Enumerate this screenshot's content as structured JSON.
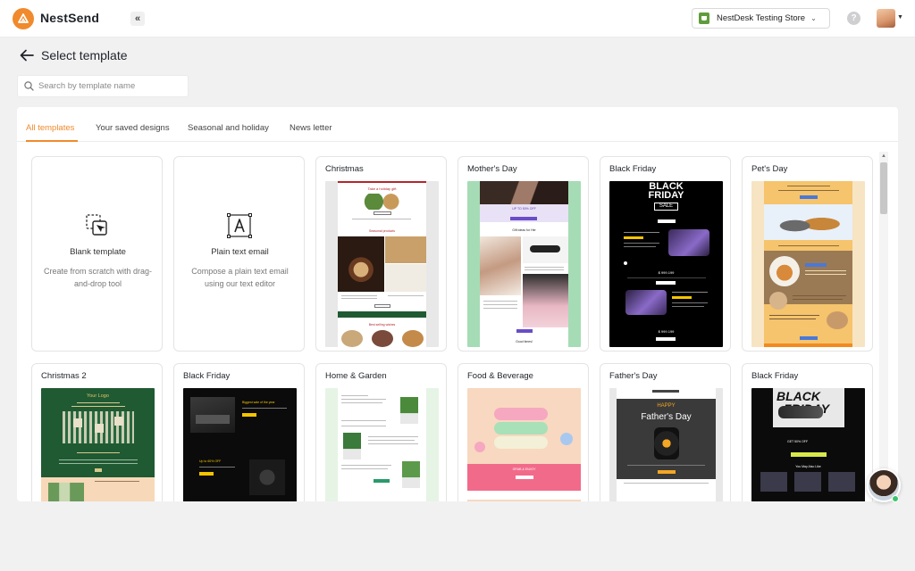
{
  "app": {
    "name": "NestSend",
    "store_name": "NestDesk Testing Store",
    "help_label": "?"
  },
  "page": {
    "title": "Select template",
    "search_placeholder": "Search by template name"
  },
  "tabs": [
    {
      "label": "All templates",
      "active": true
    },
    {
      "label": "Your saved designs",
      "active": false
    },
    {
      "label": "Seasonal and holiday",
      "active": false
    },
    {
      "label": "News letter",
      "active": false
    }
  ],
  "blank_cards": [
    {
      "title": "Blank template",
      "description": "Create from scratch with drag-and-drop tool",
      "icon": "drag-drop-icon"
    },
    {
      "title": "Plain text email",
      "description": "Compose a plain text email using our text editor",
      "icon": "text-edit-icon"
    }
  ],
  "templates": [
    {
      "title": "Christmas"
    },
    {
      "title": "Mother's Day"
    },
    {
      "title": "Black Friday"
    },
    {
      "title": "Pet's Day"
    },
    {
      "title": "Christmas 2"
    },
    {
      "title": "Black Friday"
    },
    {
      "title": "Home & Garden"
    },
    {
      "title": "Food & Beverage"
    },
    {
      "title": "Father's Day"
    },
    {
      "title": "Black Friday"
    }
  ],
  "thumb_text": {
    "christmas_header": "Take a holiday gift",
    "christmas_section": "Seasonal products",
    "christmas_bottom": "Best selling wishes",
    "mothers_offer": "UP TO 50% OFF",
    "mothers_gift": "Gift ideas for Her",
    "mothers_footer": "Good times!",
    "bf_title_1": "BLACK",
    "bf_title_2": "FRIDAY",
    "bf_sale": "SALE",
    "bf_price_1": "$ 999.199",
    "bf_price_2": "$ 999.199",
    "xmas2_logo": "Your Logo",
    "bf2_headline": "Biggest sale of the year",
    "bf2_offer": "Up to 60% OFF",
    "fathers_happy": "HAPPY",
    "fathers_title": "Father's Day",
    "bf3_black": "BLACK",
    "bf3_friday": "FRIDAY",
    "bf3_tag": "GET 50% OFF",
    "bf3_like": "You May Also Like",
    "food_banner": "GRAB & ENJOY"
  },
  "colors": {
    "accent": "#f08a2c",
    "christmas_green": "#1f5a33",
    "mothers_bg": "#a6dcb5",
    "pets_bg": "#f5c46c",
    "food_bg": "#f8d8c0"
  }
}
